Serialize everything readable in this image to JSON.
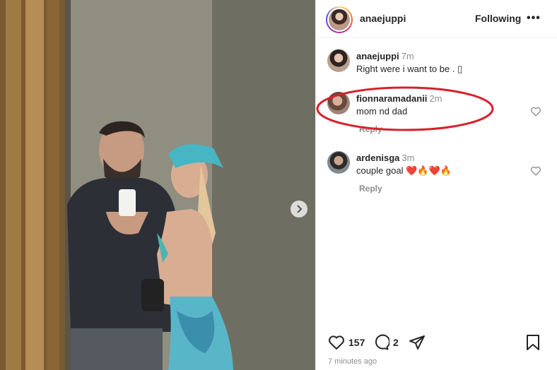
{
  "post": {
    "author": "anaejuppi",
    "follow_label": "Following",
    "more_label": "•••",
    "caption": {
      "user": "anaejuppi",
      "time": "7m",
      "text": "Right were i want to be . ▯"
    },
    "comments": [
      {
        "user": "fionnaramadanii",
        "time": "2m",
        "text": "mom nd dad",
        "reply_label": "Reply"
      },
      {
        "user": "ardenisga",
        "time": "3m",
        "text": "couple goal ❤️🔥❤️🔥",
        "reply_label": "Reply"
      }
    ],
    "likes": "157",
    "comment_count": "2",
    "posted": "7 minutes ago"
  },
  "colors": {
    "annotation": "#d8202a",
    "text_primary": "#262626",
    "text_secondary": "#8e8e8e"
  },
  "icons": [
    "chevron-right-icon",
    "heart-icon",
    "comment-icon",
    "share-icon",
    "bookmark-icon"
  ]
}
